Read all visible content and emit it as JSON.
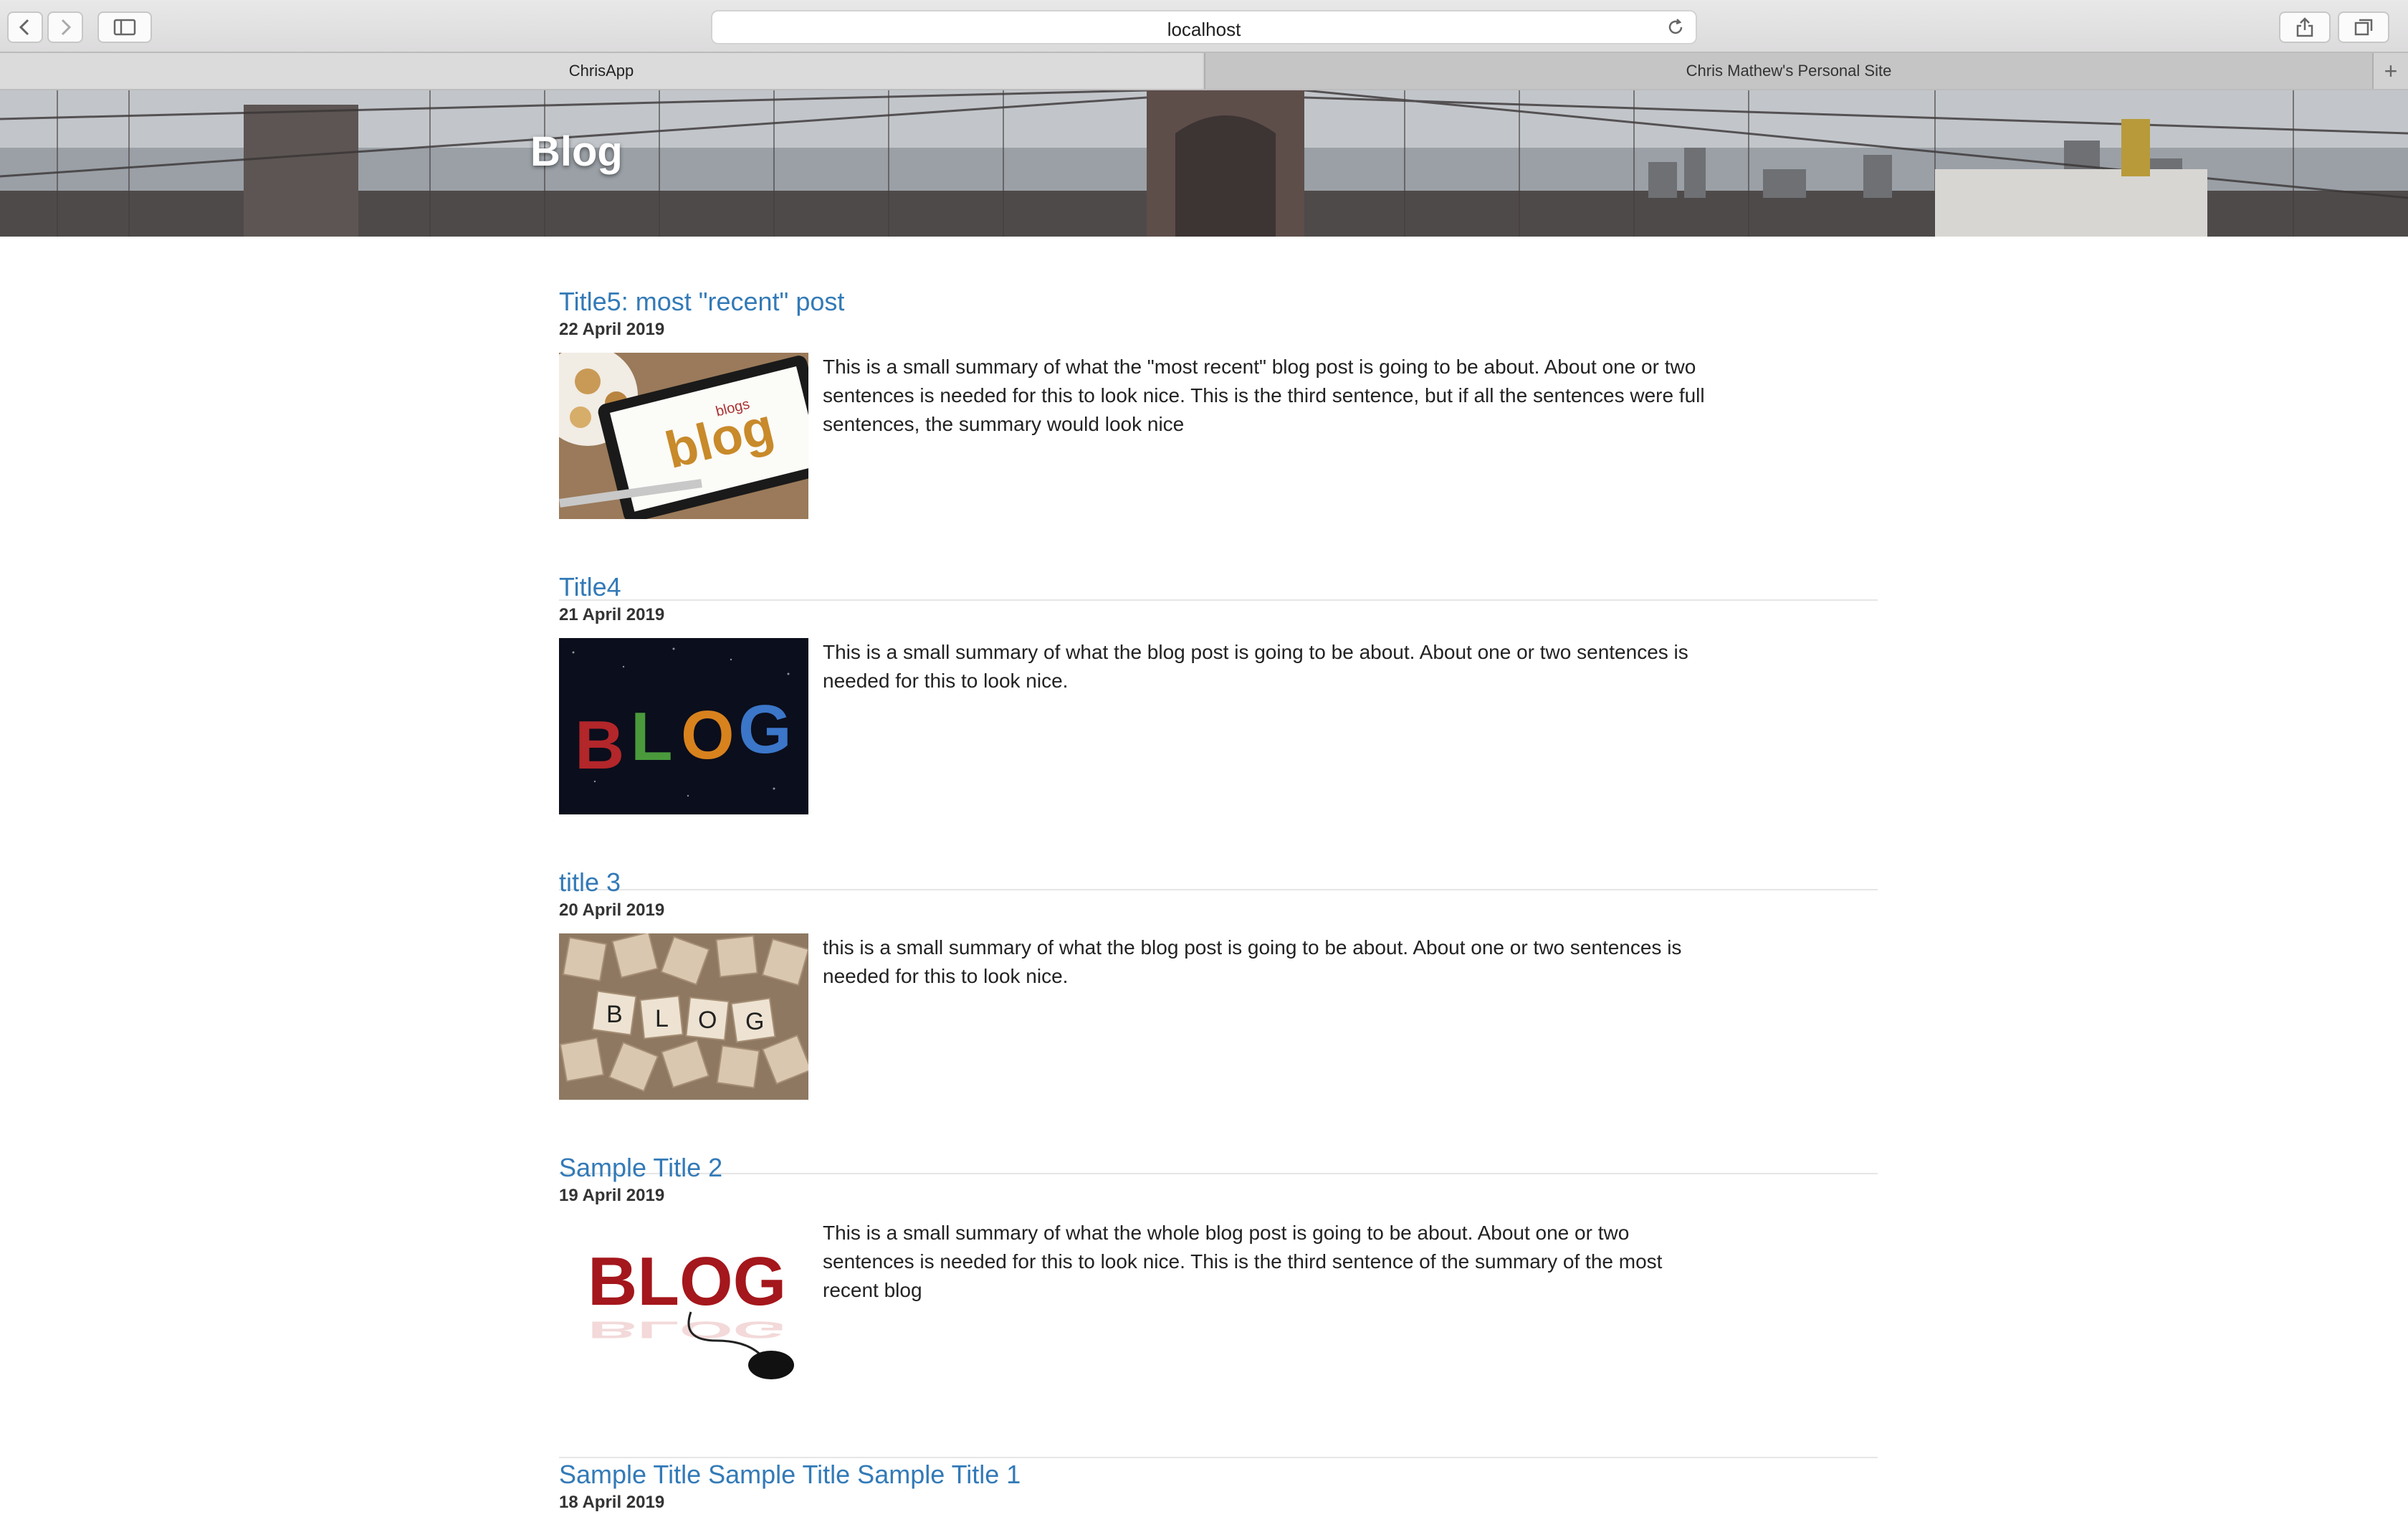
{
  "browser": {
    "url": "localhost",
    "tabs": [
      {
        "label": "ChrisApp",
        "active": true
      },
      {
        "label": "Chris Mathew's Personal Site",
        "active": false
      }
    ]
  },
  "page": {
    "heading": "Blog"
  },
  "posts": [
    {
      "title": "Title5: most \"recent\" post",
      "date": "22 April 2019",
      "summary": "This is a small summary of what the \"most recent\" blog post is going to be about. About one or two sentences is needed for this to look nice. This is the third sentence, but if all the sentences were full sentences, the summary would look nice",
      "thumbnail": "tablet-word-cloud-image"
    },
    {
      "title": "Title4",
      "date": "21 April 2019",
      "summary": "This is a small summary of what the blog post is going to be about. About one or two sentences is needed for this to look nice.",
      "thumbnail": "colorful-3d-letters-image"
    },
    {
      "title": "title 3",
      "date": "20 April 2019",
      "summary": "this is a small summary of what the blog post is going to be about. About one or two sentences is needed for this to look nice.",
      "thumbnail": "wooden-tiles-image"
    },
    {
      "title": "Sample Title 2",
      "date": "19 April 2019",
      "summary": "This is a small summary of what the whole blog post is going to be about. About one or two sentences is needed for this to look nice. This is the third sentence of the summary of the most recent blog",
      "thumbnail": "red-letters-mouse-image"
    },
    {
      "title": "Sample Title Sample Title Sample Title 1",
      "date": "18 April 2019"
    }
  ],
  "thumbnail_texts": {
    "tablet": "blog",
    "tablet_small": "blogs",
    "letters": [
      "B",
      "L",
      "O",
      "G"
    ],
    "tiles": [
      "B",
      "L",
      "O",
      "G"
    ],
    "red": "BLOG"
  }
}
